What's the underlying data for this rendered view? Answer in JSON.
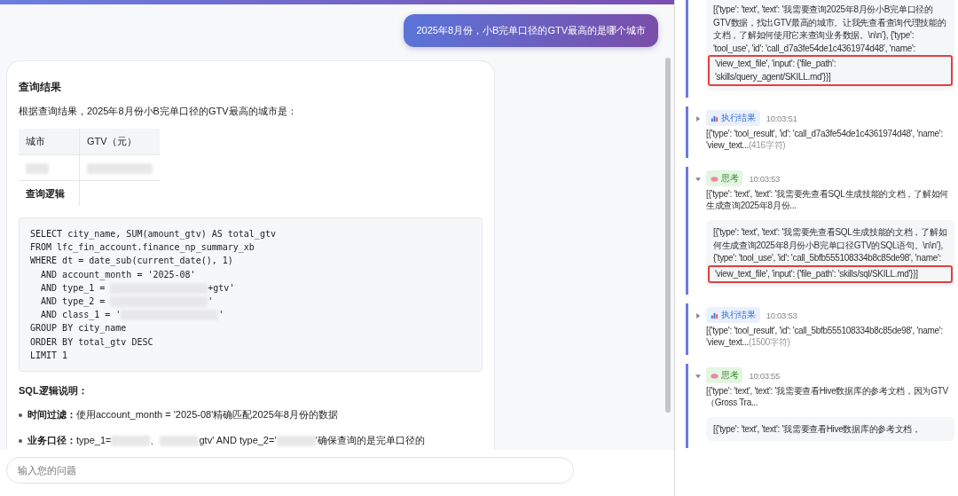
{
  "chat": {
    "user_message": "2025年8月份，小B完单口径的GTV最高的是哪个城市",
    "answer": {
      "title": "查询结果",
      "intro": "根据查询结果，2025年8月份小B完单口径的GTV最高的城市是：",
      "table": {
        "columns": [
          "城市",
          "GTV（元）"
        ],
        "rows": [
          [
            {
              "kind": "redacted"
            },
            {
              "kind": "redacted"
            }
          ],
          [
            {
              "kind": "text",
              "text": "查询逻辑"
            },
            {
              "kind": "empty"
            }
          ]
        ]
      },
      "sql": [
        [
          {
            "kind": "text",
            "text": "SELECT city_name, SUM(amount_gtv) AS total_gtv"
          }
        ],
        [
          {
            "kind": "text",
            "text": "FROM lfc_fin_account.finance_np_summary_xb"
          }
        ],
        [
          {
            "kind": "text",
            "text": "WHERE dt = date_sub(current_date(), 1)"
          }
        ],
        [
          {
            "kind": "text",
            "text": "  AND account_month = '2025-08'"
          }
        ],
        [
          {
            "kind": "text",
            "text": "  AND type_1 = "
          },
          {
            "kind": "redacted"
          },
          {
            "kind": "text",
            "text": "+gtv'"
          }
        ],
        [
          {
            "kind": "text",
            "text": "  AND type_2 = "
          },
          {
            "kind": "redacted"
          },
          {
            "kind": "text",
            "text": "'"
          }
        ],
        [
          {
            "kind": "text",
            "text": "  AND class_1 = '"
          },
          {
            "kind": "redacted"
          },
          {
            "kind": "text",
            "text": "'"
          }
        ],
        [
          {
            "kind": "text",
            "text": "GROUP BY city_name"
          }
        ],
        [
          {
            "kind": "text",
            "text": "ORDER BY total_gtv DESC"
          }
        ],
        [
          {
            "kind": "text",
            "text": "LIMIT 1"
          }
        ]
      ],
      "explain_title": "SQL逻辑说明：",
      "bullets": [
        {
          "label": "时间过滤：",
          "segments": [
            {
              "kind": "text",
              "text": "使用account_month = '2025-08'精确匹配2025年8月份的数据"
            }
          ]
        },
        {
          "label": "业务口径：",
          "segments": [
            {
              "kind": "text",
              "text": "type_1="
            },
            {
              "kind": "redacted"
            },
            {
              "kind": "text",
              "text": "、"
            },
            {
              "kind": "redacted"
            },
            {
              "kind": "text",
              "text": "gtv' AND type_2='"
            },
            {
              "kind": "redacted"
            },
            {
              "kind": "text",
              "text": "'确保查询的是完单口径的"
            }
          ]
        }
      ]
    },
    "input": {
      "placeholder": "输入您的问题"
    }
  },
  "trace": {
    "top_detail": {
      "text": "[{'type': 'text', 'text': '我需要查询2025年8月份小B完单口径的GTV数据，找出GTV最高的城市。让我先查看查询代理技能的文档，了解如何使用它来查询业务数据。\\n\\n'}, {'type': 'tool_use', 'id': 'call_d7a3fe54de1c4361974d48', 'name':",
      "highlight": "'view_text_file', 'input': {'file_path': 'skills/query_agent/SKILL.md'}}]"
    },
    "steps": [
      {
        "kind": "result",
        "label": "执行结果",
        "time": "10:03:51",
        "expanded": false,
        "summary": "[{'type': 'tool_result', 'id': 'call_d7a3fe54de1c4361974d48', 'name': 'view_text...",
        "size": "(416字符)"
      },
      {
        "kind": "thinking",
        "label": "思考",
        "time": "10:03:53",
        "expanded": true,
        "summary": "[{'type': 'text', 'text': '我需要先查看SQL生成技能的文档，了解如何生成查询2025年8月份...",
        "detail": {
          "text": "[{'type': 'text', 'text': '我需要先查看SQL生成技能的文档，了解如何生成查询2025年8月份小B完单口径GTV的SQL语句。\\n\\n'}, {'type': 'tool_use', 'id': 'call_5bfb555108334b8c85de98', 'name':",
          "highlight": "'view_text_file', 'input': {'file_path': 'skills/sql/SKILL.md'}}]"
        }
      },
      {
        "kind": "result",
        "label": "执行结果",
        "time": "10:03:53",
        "expanded": false,
        "summary": "[{'type': 'tool_result', 'id': 'call_5bfb555108334b8c85de98', 'name': 'view_text...",
        "size": "(1500字符)"
      },
      {
        "kind": "thinking",
        "label": "思考",
        "time": "10:03:55",
        "expanded": true,
        "summary": "[{'type': 'text', 'text': '我需要查看Hive数据库的参考文档，因为GTV（Gross Tra...",
        "detail": {
          "text": "[{'type': 'text', 'text': '我需要查看Hive数据库的参考文档，"
        }
      }
    ]
  }
}
